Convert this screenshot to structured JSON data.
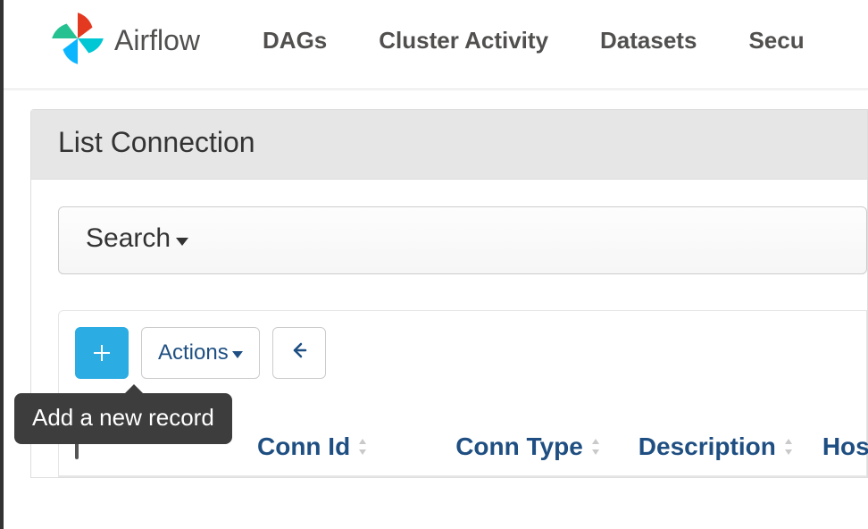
{
  "brand": {
    "name": "Airflow"
  },
  "nav": {
    "items": [
      "DAGs",
      "Cluster Activity",
      "Datasets",
      "Secu"
    ]
  },
  "page": {
    "title": "List Connection"
  },
  "search": {
    "label": "Search"
  },
  "toolbar": {
    "actions_label": "Actions",
    "add_tooltip": "Add a new record"
  },
  "table": {
    "columns": [
      "Conn Id",
      "Conn Type",
      "Description",
      "Hos"
    ]
  }
}
